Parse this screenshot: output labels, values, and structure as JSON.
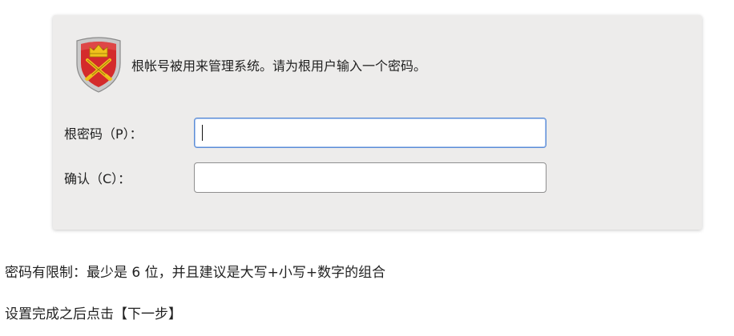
{
  "dialog": {
    "description": "根帐号被用来管理系统。请为根用户输入一个密码。",
    "icon": "root-shield-icon",
    "fields": {
      "root_password": {
        "label": "根密码（P）：",
        "value": "",
        "focused": true
      },
      "confirm": {
        "label": "确认（C）：",
        "value": ""
      }
    }
  },
  "notes": {
    "password_rule": "密码有限制：最少是 6 位，并且建议是大写+小写+数字的组合",
    "next_step": "设置完成之后点击【下一步】"
  },
  "colors": {
    "dialog_bg": "#edeceb",
    "focus_border": "#5b8cd6",
    "shield_red": "#d42b2b",
    "shield_gold": "#f0c21b"
  }
}
